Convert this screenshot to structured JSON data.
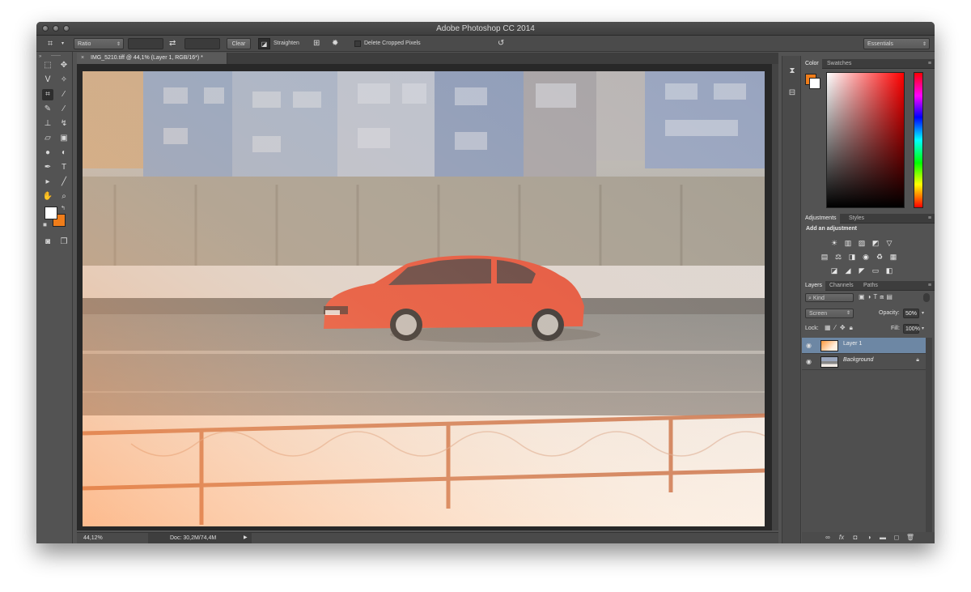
{
  "window": {
    "title": "Adobe Photoshop CC 2014"
  },
  "options_bar": {
    "crop_icon": "crop-icon",
    "ratio_select": "Ratio",
    "swap_icon": "swap-icon",
    "clear_button": "Clear",
    "straighten_label": "Straighten",
    "grid_icon": "grid-overlay-icon",
    "settings_icon": "gear-icon",
    "delete_cropped_label": "Delete Cropped Pixels",
    "reset_icon": "rotate-reset-icon",
    "workspace_select": "Essentials"
  },
  "document": {
    "tab_label": "IMG_5210.tiff @ 44,1% (Layer 1, RGB/16*) *",
    "tab_close": "×",
    "zoom": "44,12%",
    "doc_info": "Doc: 30,2M/74,4M"
  },
  "color_panel": {
    "tabs": [
      "Color",
      "Swatches"
    ],
    "foreground": "#ffffff",
    "background": "#f07d1a"
  },
  "adjustments_panel": {
    "tabs": [
      "Adjustments",
      "Styles"
    ],
    "heading": "Add an adjustment",
    "row1": [
      "☀",
      "▥",
      "▨",
      "◩",
      "▽"
    ],
    "row2": [
      "▤",
      "⚖",
      "◨",
      "◉",
      "♻",
      "▦"
    ],
    "row3": [
      "◪",
      "◢",
      "◤",
      "▭",
      "◧"
    ]
  },
  "layers_panel": {
    "tabs": [
      "Layers",
      "Channels",
      "Paths"
    ],
    "filter": "Kind",
    "blend_mode": "Screen",
    "opacity_label": "Opacity:",
    "opacity_value": "50%",
    "lock_label": "Lock:",
    "fill_label": "Fill:",
    "fill_value": "100%",
    "layers": [
      {
        "name": "Layer 1",
        "selected": true
      },
      {
        "name": "Background",
        "selected": false
      }
    ],
    "bottom_icons": [
      "∞",
      "fx",
      "◘",
      "◑",
      "▬",
      "◻",
      "🗑"
    ]
  },
  "colors": {
    "ui_bg": "#535353",
    "accent_orange": "#f07d1a",
    "selection_blue": "#6d87a4"
  }
}
